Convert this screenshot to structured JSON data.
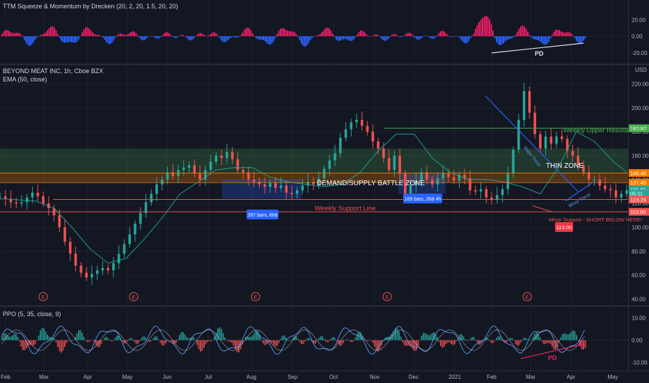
{
  "chart_data": [
    {
      "type": "bar",
      "title": "TTM Squeeze & Momentum by Drecken (20, 2, 20, 1.5, 20, 20)",
      "y_ticks": [
        "20.00",
        "0.00",
        "-20.00"
      ],
      "ylim": [
        -32,
        32
      ],
      "colors": {
        "positive": "#e91e63",
        "negative": "#2962ff"
      },
      "annotations": [
        "PD"
      ]
    },
    {
      "type": "line",
      "title": "BEYOND MEAT INC, 1h, Cboe BZX",
      "subtitle": "EMA (50, close)",
      "currency": "USD",
      "y_ticks": [
        "220.00",
        "200.00",
        "180.00",
        "160.00",
        "140.00",
        "120.00",
        "100.00",
        "80.00",
        "60.00",
        "40.00"
      ],
      "ylim": [
        35,
        232
      ],
      "x_ticks": [
        "Feb",
        "Mar",
        "Apr",
        "May",
        "Jun",
        "Jul",
        "Aug",
        "Sep",
        "Oct",
        "Nov",
        "Dec",
        "2021",
        "Feb",
        "Mar",
        "Apr",
        "May"
      ],
      "series": [
        {
          "name": "",
          "color": "#26a69a",
          "x": [
            0,
            3,
            6,
            9,
            12,
            15,
            18,
            21,
            24,
            27,
            30,
            33,
            36,
            39,
            42,
            45,
            48,
            51,
            54,
            57,
            60,
            63,
            66,
            69,
            72,
            75,
            78,
            81,
            84,
            87,
            90,
            93,
            96,
            99,
            102,
            105,
            108,
            111,
            114,
            117,
            120,
            123,
            126,
            129,
            132,
            135,
            138,
            141,
            144,
            147,
            150,
            153,
            156,
            159,
            162,
            165,
            168,
            171,
            174,
            177,
            180,
            183,
            186,
            189,
            192,
            195,
            198,
            201,
            204,
            207,
            210,
            213,
            216,
            219,
            222,
            225,
            228,
            231,
            234,
            237,
            240,
            243,
            246,
            249,
            252,
            255,
            258,
            261,
            264,
            267,
            270,
            273,
            276,
            279,
            282,
            285,
            288,
            291,
            294,
            297,
            300,
            303,
            306,
            309,
            312,
            315,
            318,
            321,
            324,
            327,
            330,
            333,
            336,
            339,
            342,
            345,
            348
          ],
          "y": [
            126,
            124,
            121,
            120,
            121,
            125,
            129,
            126,
            120,
            116,
            110,
            100,
            88,
            78,
            68,
            62,
            58,
            61,
            64,
            66,
            64,
            70,
            78,
            86,
            94,
            103,
            112,
            121,
            128,
            136,
            140,
            146,
            143,
            148,
            150,
            152,
            145,
            140,
            148,
            155,
            160,
            158,
            163,
            157,
            148,
            146,
            140,
            138,
            136,
            134,
            137,
            133,
            135,
            129,
            128,
            131,
            135,
            138,
            136,
            141,
            149,
            156,
            162,
            175,
            182,
            188,
            190,
            185,
            180,
            172,
            166,
            158,
            148,
            160,
            145,
            128,
            135,
            139,
            146,
            140,
            136,
            141,
            145,
            142,
            139,
            144,
            141,
            131,
            130,
            132,
            125,
            123,
            127,
            132,
            145,
            165,
            190,
            214,
            196,
            178,
            166,
            176,
            170,
            176,
            174,
            164,
            160,
            152,
            146,
            140,
            140,
            135,
            132,
            131,
            125,
            128,
            131
          ]
        },
        {
          "name": "EMA (50, close)",
          "color": "#2962ff",
          "x": [
            0,
            10,
            20,
            30,
            40,
            50,
            60,
            70,
            80,
            90,
            100,
            110,
            120,
            130,
            140,
            150,
            160,
            170,
            180,
            190,
            200,
            210,
            220,
            230,
            240,
            250,
            260,
            270,
            280,
            290,
            300,
            310,
            320,
            330,
            340,
            348
          ],
          "y": [
            124,
            123,
            122,
            116,
            100,
            82,
            70,
            74,
            90,
            108,
            128,
            138,
            148,
            150,
            150,
            142,
            138,
            136,
            134,
            136,
            146,
            164,
            178,
            178,
            158,
            146,
            140,
            140,
            138,
            134,
            128,
            150,
            180,
            172,
            156,
            146
          ]
        }
      ],
      "levels": [
        {
          "label": "Weekly Upper Resistance",
          "value": 182.97,
          "color": "#4caf50"
        },
        {
          "label": "145.48",
          "value": 145.48,
          "color": "#f57c00"
        },
        {
          "label": "137.45",
          "value": 137.45,
          "color": "#f57c00"
        },
        {
          "label": "Weekly Support Line",
          "value": 123.29,
          "color": "#ef5350"
        },
        {
          "label": "Minor Support - SHORT BELOW HERE!",
          "value": 113.0,
          "color": "#ef5350"
        }
      ],
      "zones": [
        {
          "label": "DEMAND/SUPPLY BATTLE ZONE",
          "from": 137.45,
          "to": 145.48,
          "color": "#f57c00"
        },
        {
          "label": "THIN ZONE",
          "from": 145.48,
          "to": 166,
          "color": "#4caf50"
        }
      ],
      "price_labels": [
        {
          "text": "182.97",
          "value": 182.97,
          "color": "#4caf50"
        },
        {
          "text": "145.48",
          "value": 145.48,
          "color": "#f57c00"
        },
        {
          "text": "137.45",
          "value": 137.45,
          "color": "#f57c00"
        },
        {
          "text": "131.61",
          "value": 131.61,
          "color": "#26a69a"
        },
        {
          "text": "05:11",
          "value": 128.5,
          "color": "#26a69a"
        },
        {
          "text": "123.29",
          "value": 123.29,
          "color": "#ef5350"
        },
        {
          "text": "113.00",
          "value": 113.0,
          "color": "#ef5350"
        }
      ],
      "annotations": [
        "287 bars, 60d",
        "169 bars, 35d 4h",
        "Major Trend",
        "Minor Trend",
        "113.00"
      ],
      "earnings_marker": "E"
    },
    {
      "type": "line",
      "title": "PPO (5, 35, close, 9)",
      "y_ticks": [
        "10.00",
        "0.00",
        "-10.00"
      ],
      "ylim": [
        -12,
        12
      ],
      "annotations": [
        "PD"
      ]
    }
  ]
}
